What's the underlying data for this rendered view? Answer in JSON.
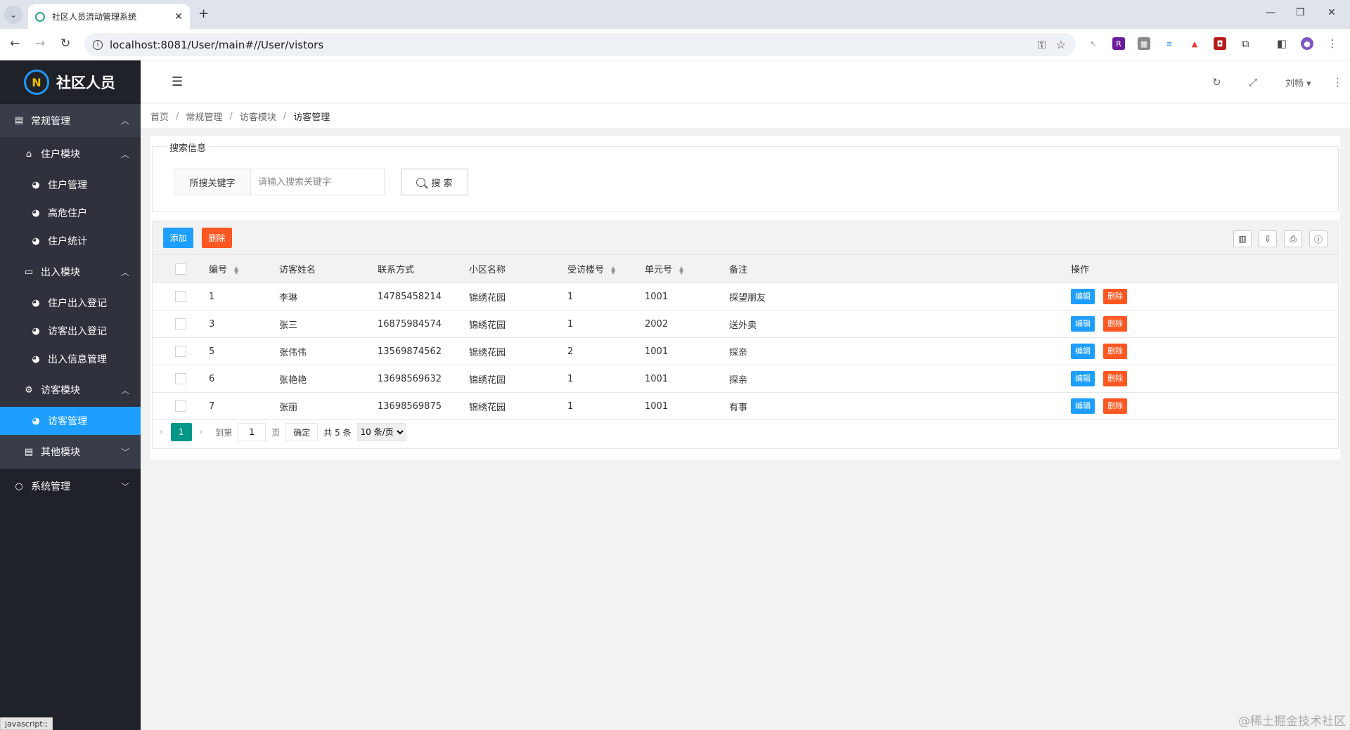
{
  "browser": {
    "tab_title": "社区人员流动管理系统",
    "url": "localhost:8081/User/main#//User/vistors"
  },
  "sidebar": {
    "logo_text": "社区人员",
    "menu": [
      {
        "label": "常规管理"
      },
      {
        "label": "住户模块"
      },
      {
        "label": "住户管理"
      },
      {
        "label": "高危住户"
      },
      {
        "label": "住户统计"
      },
      {
        "label": "出入模块"
      },
      {
        "label": "住户出入登记"
      },
      {
        "label": "访客出入登记"
      },
      {
        "label": "出入信息管理"
      },
      {
        "label": "访客模块"
      },
      {
        "label": "访客管理"
      },
      {
        "label": "其他模块"
      },
      {
        "label": "系统管理"
      }
    ]
  },
  "header": {
    "user_name": "刘畅"
  },
  "breadcrumb": [
    "首页",
    "常规管理",
    "访客模块",
    "访客管理"
  ],
  "search": {
    "legend": "搜索信息",
    "label": "所搜关键字",
    "placeholder": "请输入搜索关键字",
    "button": "搜 索"
  },
  "toolbar": {
    "add_label": "添加",
    "delete_label": "删除"
  },
  "table": {
    "columns": [
      "编号",
      "访客姓名",
      "联系方式",
      "小区名称",
      "受访楼号",
      "单元号",
      "备注",
      "操作"
    ],
    "rows": [
      [
        "1",
        "李琳",
        "14785458214",
        "锦绣花园",
        "1",
        "1001",
        "探望朋友"
      ],
      [
        "3",
        "张三",
        "16875984574",
        "锦绣花园",
        "1",
        "2002",
        "送外卖"
      ],
      [
        "5",
        "张伟伟",
        "13569874562",
        "锦绣花园",
        "2",
        "1001",
        "探亲"
      ],
      [
        "6",
        "张艳艳",
        "13698569632",
        "锦绣花园",
        "1",
        "1001",
        "探亲"
      ],
      [
        "7",
        "张丽",
        "13698569875",
        "锦绣花园",
        "1",
        "1001",
        "有事"
      ]
    ],
    "edit_label": "编辑",
    "row_delete_label": "删除"
  },
  "pager": {
    "current": "1",
    "goto_prefix": "到第",
    "goto_value": "1",
    "goto_suffix": "页",
    "confirm": "确定",
    "total": "共 5 条",
    "page_size": "10 条/页"
  },
  "status_hint": "javascript:;",
  "watermark": "@稀土掘金技术社区",
  "colors": {
    "primary": "#1e9fff",
    "danger": "#ff5722",
    "pager_active": "#009688",
    "sidebar_bg": "#20222a"
  }
}
